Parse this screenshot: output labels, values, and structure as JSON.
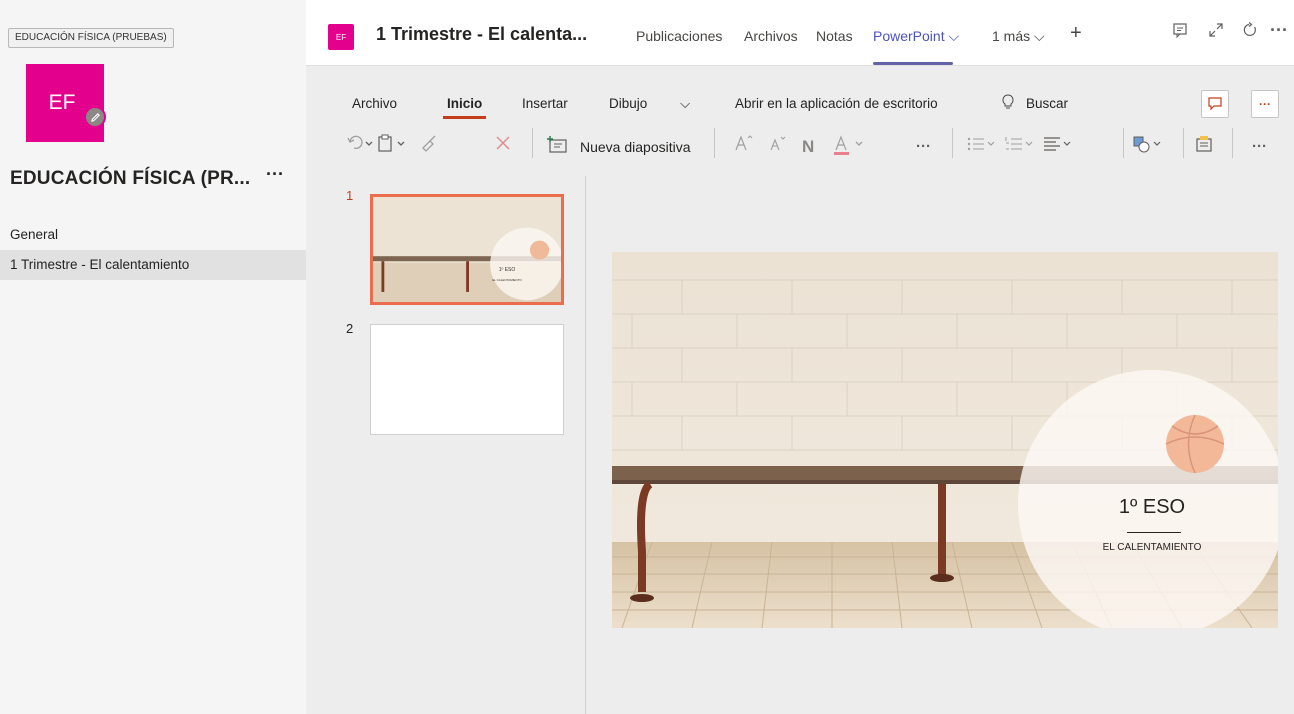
{
  "sidebar": {
    "tooltip": "EDUCACIÓN FÍSICA (PRUEBAS)",
    "team_avatar_text": "EF",
    "team_name": "EDUCACIÓN FÍSICA (PR...",
    "more": "···",
    "channels": [
      {
        "label": "General",
        "active": false
      },
      {
        "label": "1 Trimestre - El calentamiento",
        "active": true
      }
    ]
  },
  "header": {
    "avatar_text": "EF",
    "title": "1 Trimestre - El calenta...",
    "tabs": [
      {
        "label": "Publicaciones"
      },
      {
        "label": "Archivos"
      },
      {
        "label": "Notas"
      },
      {
        "label": "PowerPoint ⌵",
        "active": true
      },
      {
        "label": "1 más ⌵"
      }
    ],
    "add": "+",
    "icons": [
      "conversation-icon",
      "expand-icon",
      "reload-icon",
      "more-icon"
    ]
  },
  "ribbon": {
    "menus": [
      "Archivo",
      "Inicio",
      "Insertar",
      "Dibujo",
      "⌵",
      "Abrir en la aplicación de escritorio",
      "Buscar"
    ],
    "active_menu": "Inicio",
    "new_slide": "Nueva diapositiva",
    "bold_glyph": "N",
    "more": "···"
  },
  "thumbnails": [
    {
      "num": "1",
      "selected": true,
      "title": "1º ESO",
      "sub": "EL CALENTAMIENTO"
    },
    {
      "num": "2",
      "selected": false
    }
  ],
  "slide": {
    "title": "1º ESO",
    "subtitle": "EL CALENTAMIENTO"
  },
  "colors": {
    "brand_pink": "#e3008c",
    "teams_purple": "#6264a7",
    "ppt_orange": "#c43e1c"
  }
}
